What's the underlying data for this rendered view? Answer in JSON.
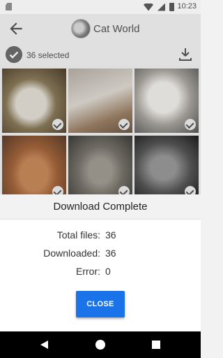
{
  "status_bar": {
    "time": "10:23"
  },
  "app_bar": {
    "title": "Cat World"
  },
  "selection": {
    "count_label": "36 selected"
  },
  "grid": {
    "tiles": 6
  },
  "dialog": {
    "title": "Download Complete",
    "rows": [
      {
        "label": "Total files:",
        "value": "36"
      },
      {
        "label": "Downloaded:",
        "value": "36"
      },
      {
        "label": "Error:",
        "value": "0"
      }
    ],
    "close_label": "CLOSE"
  },
  "colors": {
    "accent": "#1a73e8"
  }
}
